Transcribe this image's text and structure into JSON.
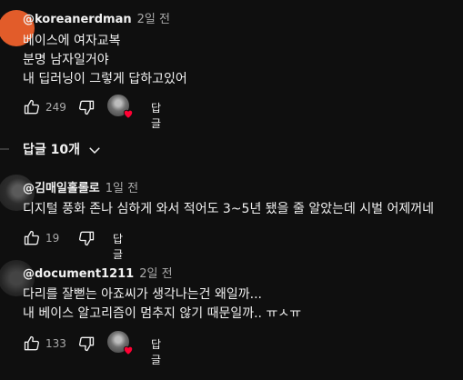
{
  "comments": [
    {
      "author": "@koreanerdman",
      "time": "2일 전",
      "lines": [
        "베이스에 여자교복",
        "분명 남자일거야",
        "내 딥러닝이 그렇게 답하고있어"
      ],
      "likes": "249",
      "reply_label": "답글",
      "avatar_color": "#e25c2a"
    },
    {
      "author": "@김매일홀롤로",
      "time": "1일 전",
      "lines": [
        "디지털 풍화 존나 심하게 와서 적어도 3~5년 됐을 줄 알았는데 시벌 어제꺼네"
      ],
      "likes": "19",
      "reply_label": "답글"
    },
    {
      "author": "@document1211",
      "time": "2일 전",
      "lines": [
        "다리를 잘뻗는 아죠씨가 생각나는건 왜일까...",
        "내 베이스 알고리즘이 멈추지 않기 때문일까.. ㅠㅅㅠ"
      ],
      "likes": "133",
      "reply_label": "답글"
    }
  ],
  "replies_toggle": {
    "label": "답글 10개"
  },
  "icons": {
    "like": "thumbs-up-icon",
    "dislike": "thumbs-down-icon",
    "heart": "heart-icon",
    "chevron": "chevron-down-icon"
  },
  "colors": {
    "background": "#0f0f0f",
    "text": "#f1f1f1",
    "muted": "#aaaaaa",
    "heart": "#ff0033"
  }
}
